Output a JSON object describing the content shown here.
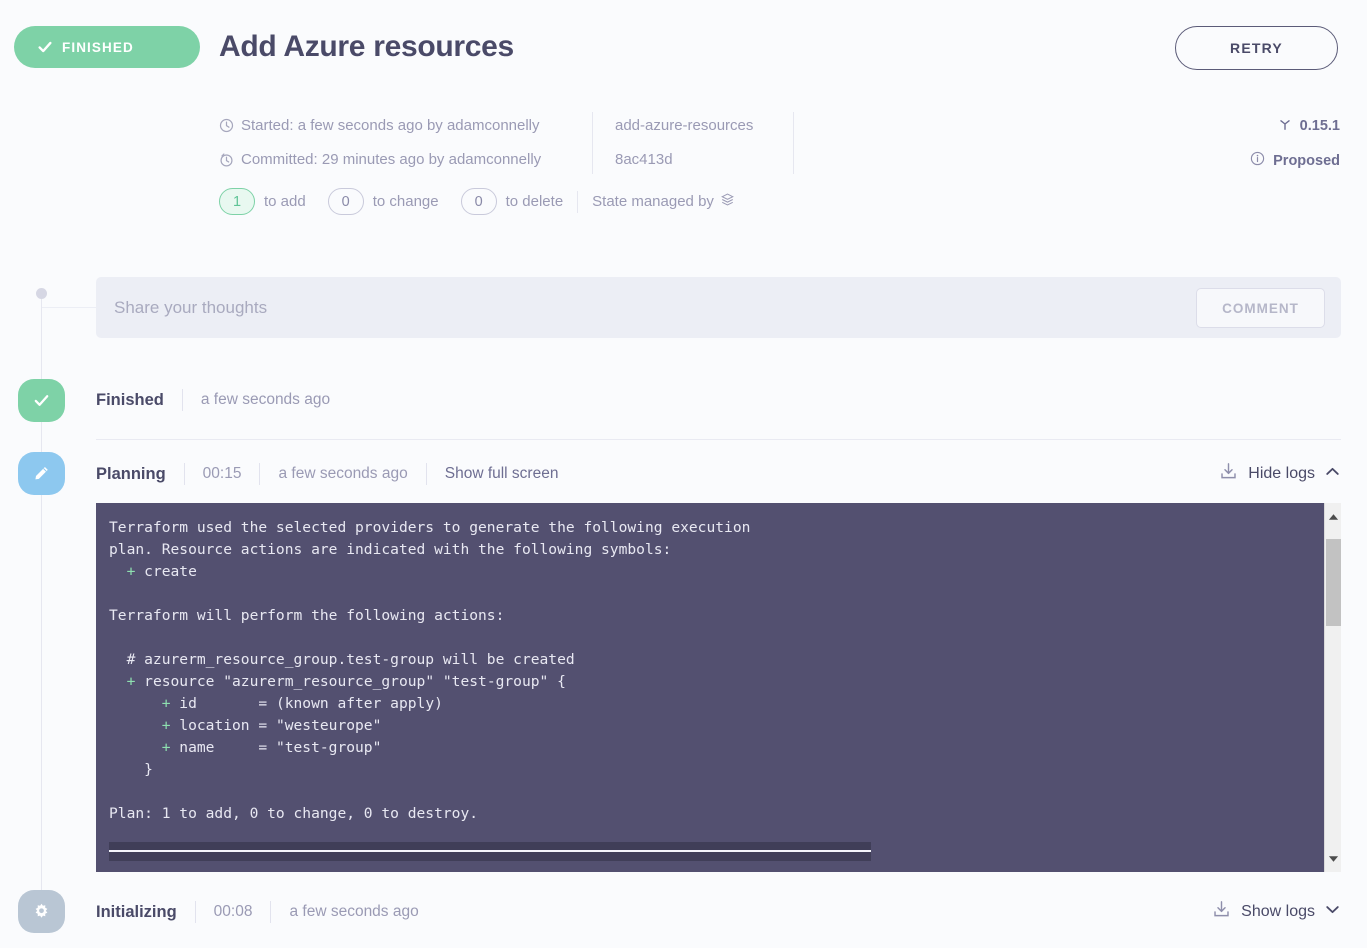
{
  "header": {
    "status_label": "FINISHED",
    "title": "Add Azure resources",
    "retry_label": "RETRY"
  },
  "meta": {
    "started": "Started: a few seconds ago by adamconnelly",
    "committed": "Committed: 29 minutes ago by adamconnelly",
    "branch": "add-azure-resources",
    "commit": "8ac413d",
    "version": "0.15.1",
    "state": "Proposed",
    "counts": [
      {
        "value": "1",
        "label": "to add",
        "accent": true
      },
      {
        "value": "0",
        "label": "to change",
        "accent": false
      },
      {
        "value": "0",
        "label": "to delete",
        "accent": false
      }
    ],
    "state_managed_by": "State managed by"
  },
  "comment": {
    "placeholder": "Share your thoughts",
    "value": "",
    "button_label": "COMMENT"
  },
  "phases": [
    {
      "name": "Finished",
      "duration": "",
      "time": "a few seconds ago",
      "fullscreen": "",
      "logs_label": ""
    },
    {
      "name": "Planning",
      "duration": "00:15",
      "time": "a few seconds ago",
      "fullscreen": "Show full screen",
      "logs_label": "Hide logs"
    },
    {
      "name": "Initializing",
      "duration": "00:08",
      "time": "a few seconds ago",
      "fullscreen": "",
      "logs_label": "Show logs"
    }
  ],
  "terminal": {
    "lines": [
      "Terraform used the selected providers to generate the following execution",
      "plan. Resource actions are indicated with the following symbols:",
      "  + create",
      "",
      "Terraform will perform the following actions:",
      "",
      "  # azurerm_resource_group.test-group will be created",
      "  + resource \"azurerm_resource_group\" \"test-group\" {",
      "      + id       = (known after apply)",
      "      + location = \"westeurope\"",
      "      + name     = \"test-group\"",
      "    }",
      "",
      "Plan: 1 to add, 0 to change, 0 to destroy."
    ]
  },
  "colors": {
    "green": "#7ed2a7",
    "blue": "#8dc8ef",
    "grey": "#b9c6d4",
    "terminal_bg": "#535070",
    "text_dark": "#4a4a68",
    "text_muted": "#9a9ab4"
  }
}
